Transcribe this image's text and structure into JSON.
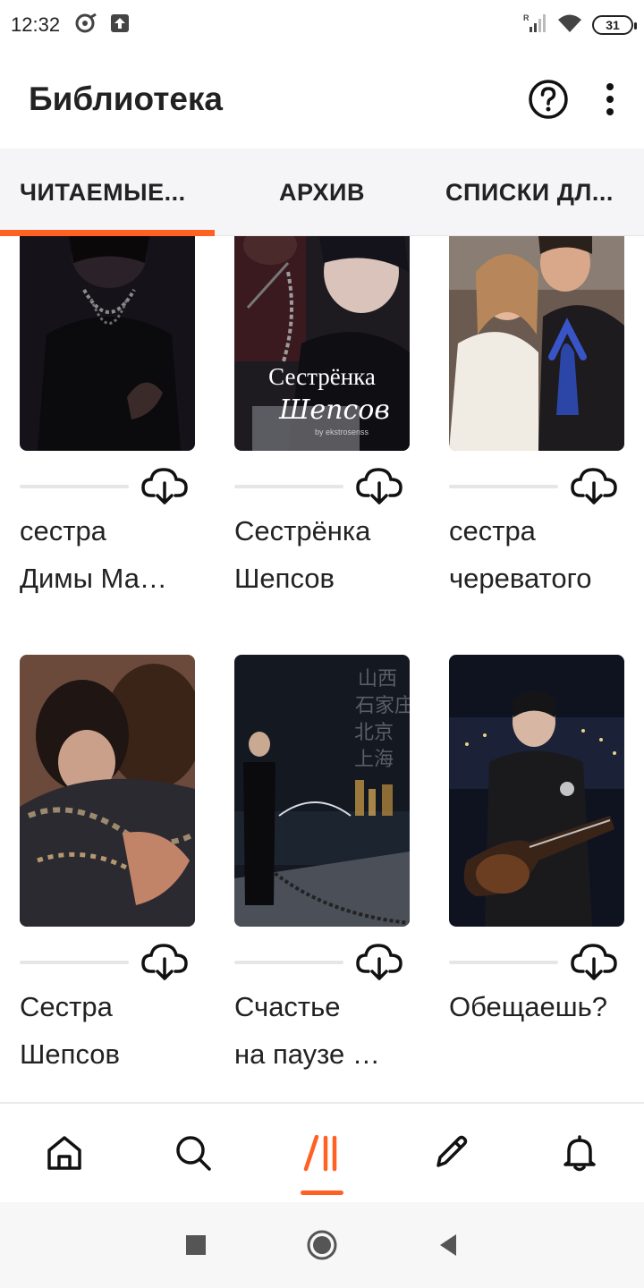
{
  "status_bar": {
    "time": "12:32",
    "battery": "31",
    "signal_label": "R"
  },
  "header": {
    "title": "Библиотека"
  },
  "tabs": [
    {
      "label": "ЧИТАЕМЫЕ...",
      "active": true
    },
    {
      "label": "АРХИВ",
      "active": false
    },
    {
      "label": "СПИСКИ ДЛ...",
      "active": false
    }
  ],
  "books": [
    {
      "title_line1": "сестра",
      "title_line2": "Димы Ма…",
      "cover_text": ""
    },
    {
      "title_line1": "Сестрёнка",
      "title_line2": "Шепсов",
      "cover_text": "Сестрёнка",
      "cover_script": "Шепсов",
      "cover_credit": "by ekstrosenss"
    },
    {
      "title_line1": "сестра",
      "title_line2": "череватого",
      "cover_text": ""
    },
    {
      "title_line1": "Сестра",
      "title_line2": "Шепсов",
      "cover_text": ""
    },
    {
      "title_line1": "Счастье",
      "title_line2": "на паузе …",
      "cover_text": "山西 石家庄 北京 上海"
    },
    {
      "title_line1": "Обещаешь?",
      "title_line2": "",
      "cover_text": ""
    }
  ],
  "bottom_nav": [
    {
      "icon": "home-icon",
      "active": false
    },
    {
      "icon": "search-icon",
      "active": false
    },
    {
      "icon": "library-icon",
      "active": true
    },
    {
      "icon": "write-icon",
      "active": false
    },
    {
      "icon": "bell-icon",
      "active": false
    }
  ],
  "colors": {
    "accent": "#ff6122",
    "text": "#222222",
    "tab_bg": "#f5f4f6"
  }
}
